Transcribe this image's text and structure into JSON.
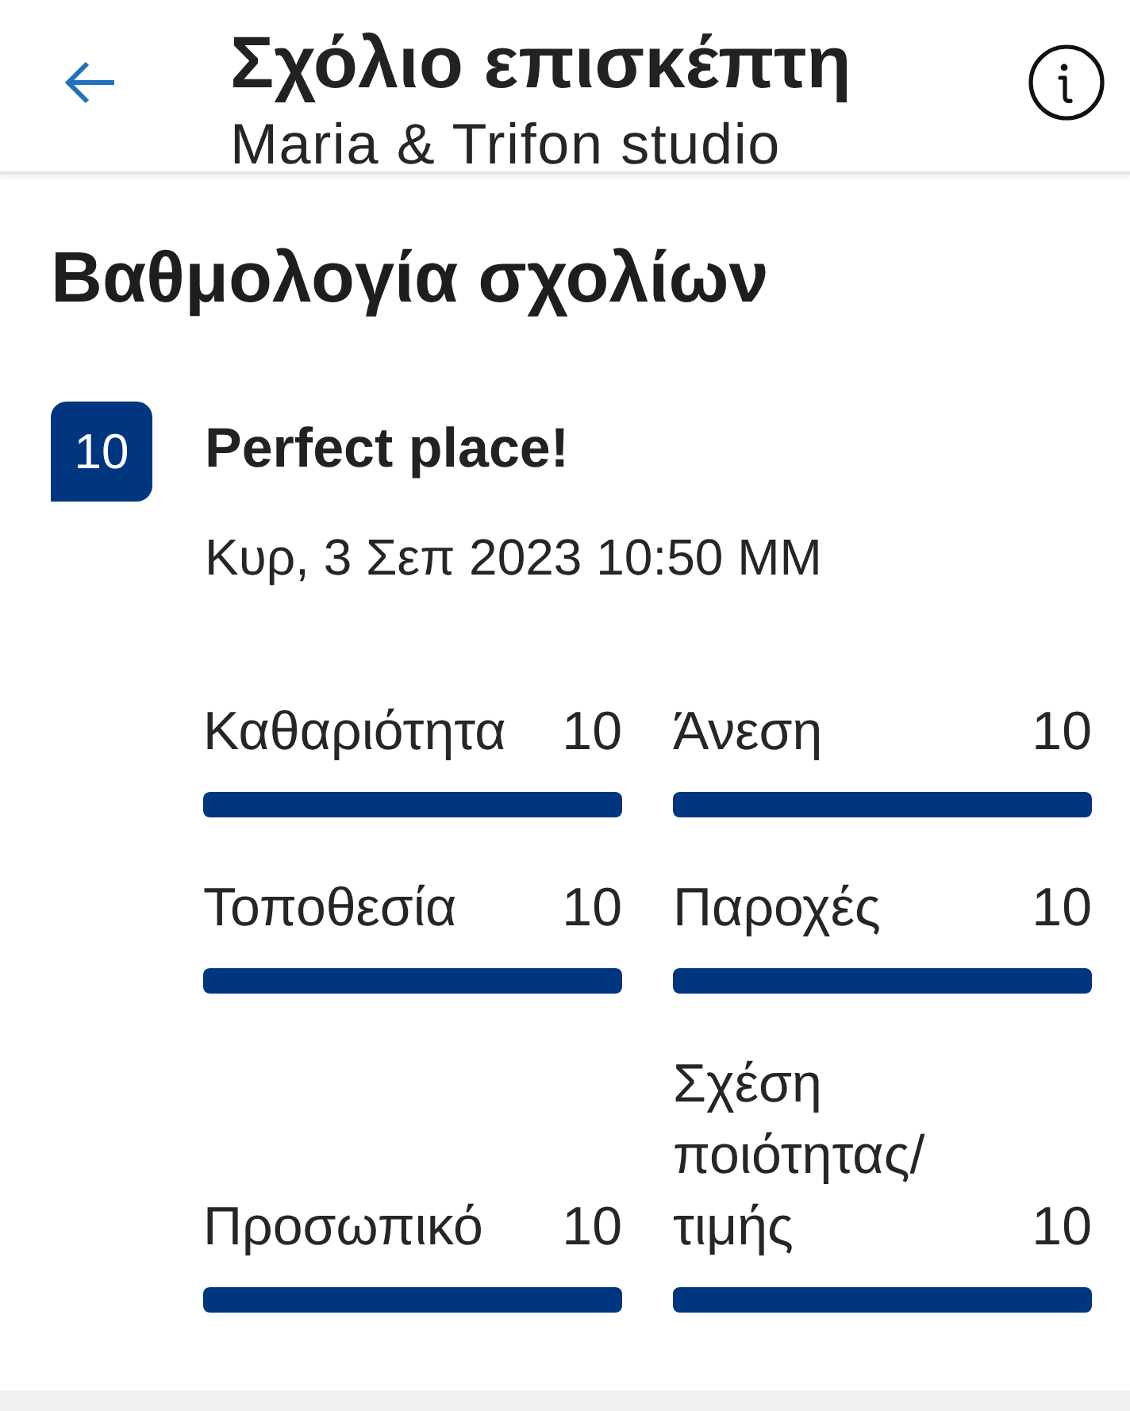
{
  "app_bar": {
    "title": "Σχόλιο επισκέπτη",
    "subtitle": "Maria & Trifon studio"
  },
  "section": {
    "title": "Βαθμολογία σχολίων"
  },
  "review": {
    "score": "10",
    "title": "Perfect place!",
    "date": "Κυρ, 3 Σεπ 2023 10:50 ΜΜ"
  },
  "ratings": [
    {
      "label": "Καθαριότητα",
      "score": "10",
      "level": 1
    },
    {
      "label": "Τοποθεσία",
      "score": "10",
      "level": 1
    },
    {
      "label": "Προσωπικό",
      "score": "10",
      "level": 1
    },
    {
      "label": "Άνεση",
      "score": "10",
      "level": 1
    },
    {
      "label": "Παροχές",
      "score": "10",
      "level": 1
    },
    {
      "label": "Σχέση ποιότητας/ τιμής",
      "score": "10",
      "level": 1
    }
  ]
}
